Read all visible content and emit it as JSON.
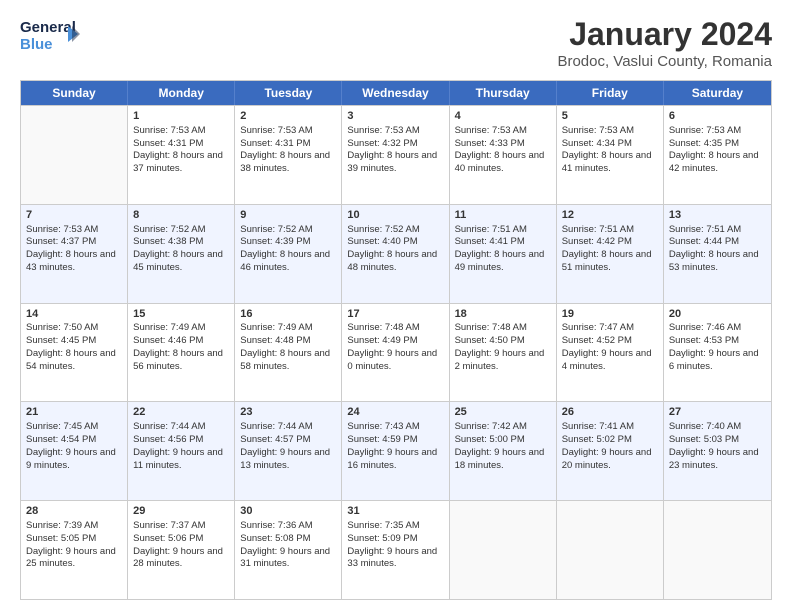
{
  "logo": {
    "line1": "General",
    "line2": "Blue"
  },
  "title": "January 2024",
  "location": "Brodoc, Vaslui County, Romania",
  "days_header": [
    "Sunday",
    "Monday",
    "Tuesday",
    "Wednesday",
    "Thursday",
    "Friday",
    "Saturday"
  ],
  "weeks": [
    [
      {
        "day": "",
        "sunrise": "",
        "sunset": "",
        "daylight": ""
      },
      {
        "day": "1",
        "sunrise": "Sunrise: 7:53 AM",
        "sunset": "Sunset: 4:31 PM",
        "daylight": "Daylight: 8 hours and 37 minutes."
      },
      {
        "day": "2",
        "sunrise": "Sunrise: 7:53 AM",
        "sunset": "Sunset: 4:31 PM",
        "daylight": "Daylight: 8 hours and 38 minutes."
      },
      {
        "day": "3",
        "sunrise": "Sunrise: 7:53 AM",
        "sunset": "Sunset: 4:32 PM",
        "daylight": "Daylight: 8 hours and 39 minutes."
      },
      {
        "day": "4",
        "sunrise": "Sunrise: 7:53 AM",
        "sunset": "Sunset: 4:33 PM",
        "daylight": "Daylight: 8 hours and 40 minutes."
      },
      {
        "day": "5",
        "sunrise": "Sunrise: 7:53 AM",
        "sunset": "Sunset: 4:34 PM",
        "daylight": "Daylight: 8 hours and 41 minutes."
      },
      {
        "day": "6",
        "sunrise": "Sunrise: 7:53 AM",
        "sunset": "Sunset: 4:35 PM",
        "daylight": "Daylight: 8 hours and 42 minutes."
      }
    ],
    [
      {
        "day": "7",
        "sunrise": "Sunrise: 7:53 AM",
        "sunset": "Sunset: 4:37 PM",
        "daylight": "Daylight: 8 hours and 43 minutes."
      },
      {
        "day": "8",
        "sunrise": "Sunrise: 7:52 AM",
        "sunset": "Sunset: 4:38 PM",
        "daylight": "Daylight: 8 hours and 45 minutes."
      },
      {
        "day": "9",
        "sunrise": "Sunrise: 7:52 AM",
        "sunset": "Sunset: 4:39 PM",
        "daylight": "Daylight: 8 hours and 46 minutes."
      },
      {
        "day": "10",
        "sunrise": "Sunrise: 7:52 AM",
        "sunset": "Sunset: 4:40 PM",
        "daylight": "Daylight: 8 hours and 48 minutes."
      },
      {
        "day": "11",
        "sunrise": "Sunrise: 7:51 AM",
        "sunset": "Sunset: 4:41 PM",
        "daylight": "Daylight: 8 hours and 49 minutes."
      },
      {
        "day": "12",
        "sunrise": "Sunrise: 7:51 AM",
        "sunset": "Sunset: 4:42 PM",
        "daylight": "Daylight: 8 hours and 51 minutes."
      },
      {
        "day": "13",
        "sunrise": "Sunrise: 7:51 AM",
        "sunset": "Sunset: 4:44 PM",
        "daylight": "Daylight: 8 hours and 53 minutes."
      }
    ],
    [
      {
        "day": "14",
        "sunrise": "Sunrise: 7:50 AM",
        "sunset": "Sunset: 4:45 PM",
        "daylight": "Daylight: 8 hours and 54 minutes."
      },
      {
        "day": "15",
        "sunrise": "Sunrise: 7:49 AM",
        "sunset": "Sunset: 4:46 PM",
        "daylight": "Daylight: 8 hours and 56 minutes."
      },
      {
        "day": "16",
        "sunrise": "Sunrise: 7:49 AM",
        "sunset": "Sunset: 4:48 PM",
        "daylight": "Daylight: 8 hours and 58 minutes."
      },
      {
        "day": "17",
        "sunrise": "Sunrise: 7:48 AM",
        "sunset": "Sunset: 4:49 PM",
        "daylight": "Daylight: 9 hours and 0 minutes."
      },
      {
        "day": "18",
        "sunrise": "Sunrise: 7:48 AM",
        "sunset": "Sunset: 4:50 PM",
        "daylight": "Daylight: 9 hours and 2 minutes."
      },
      {
        "day": "19",
        "sunrise": "Sunrise: 7:47 AM",
        "sunset": "Sunset: 4:52 PM",
        "daylight": "Daylight: 9 hours and 4 minutes."
      },
      {
        "day": "20",
        "sunrise": "Sunrise: 7:46 AM",
        "sunset": "Sunset: 4:53 PM",
        "daylight": "Daylight: 9 hours and 6 minutes."
      }
    ],
    [
      {
        "day": "21",
        "sunrise": "Sunrise: 7:45 AM",
        "sunset": "Sunset: 4:54 PM",
        "daylight": "Daylight: 9 hours and 9 minutes."
      },
      {
        "day": "22",
        "sunrise": "Sunrise: 7:44 AM",
        "sunset": "Sunset: 4:56 PM",
        "daylight": "Daylight: 9 hours and 11 minutes."
      },
      {
        "day": "23",
        "sunrise": "Sunrise: 7:44 AM",
        "sunset": "Sunset: 4:57 PM",
        "daylight": "Daylight: 9 hours and 13 minutes."
      },
      {
        "day": "24",
        "sunrise": "Sunrise: 7:43 AM",
        "sunset": "Sunset: 4:59 PM",
        "daylight": "Daylight: 9 hours and 16 minutes."
      },
      {
        "day": "25",
        "sunrise": "Sunrise: 7:42 AM",
        "sunset": "Sunset: 5:00 PM",
        "daylight": "Daylight: 9 hours and 18 minutes."
      },
      {
        "day": "26",
        "sunrise": "Sunrise: 7:41 AM",
        "sunset": "Sunset: 5:02 PM",
        "daylight": "Daylight: 9 hours and 20 minutes."
      },
      {
        "day": "27",
        "sunrise": "Sunrise: 7:40 AM",
        "sunset": "Sunset: 5:03 PM",
        "daylight": "Daylight: 9 hours and 23 minutes."
      }
    ],
    [
      {
        "day": "28",
        "sunrise": "Sunrise: 7:39 AM",
        "sunset": "Sunset: 5:05 PM",
        "daylight": "Daylight: 9 hours and 25 minutes."
      },
      {
        "day": "29",
        "sunrise": "Sunrise: 7:37 AM",
        "sunset": "Sunset: 5:06 PM",
        "daylight": "Daylight: 9 hours and 28 minutes."
      },
      {
        "day": "30",
        "sunrise": "Sunrise: 7:36 AM",
        "sunset": "Sunset: 5:08 PM",
        "daylight": "Daylight: 9 hours and 31 minutes."
      },
      {
        "day": "31",
        "sunrise": "Sunrise: 7:35 AM",
        "sunset": "Sunset: 5:09 PM",
        "daylight": "Daylight: 9 hours and 33 minutes."
      },
      {
        "day": "",
        "sunrise": "",
        "sunset": "",
        "daylight": ""
      },
      {
        "day": "",
        "sunrise": "",
        "sunset": "",
        "daylight": ""
      },
      {
        "day": "",
        "sunrise": "",
        "sunset": "",
        "daylight": ""
      }
    ]
  ]
}
